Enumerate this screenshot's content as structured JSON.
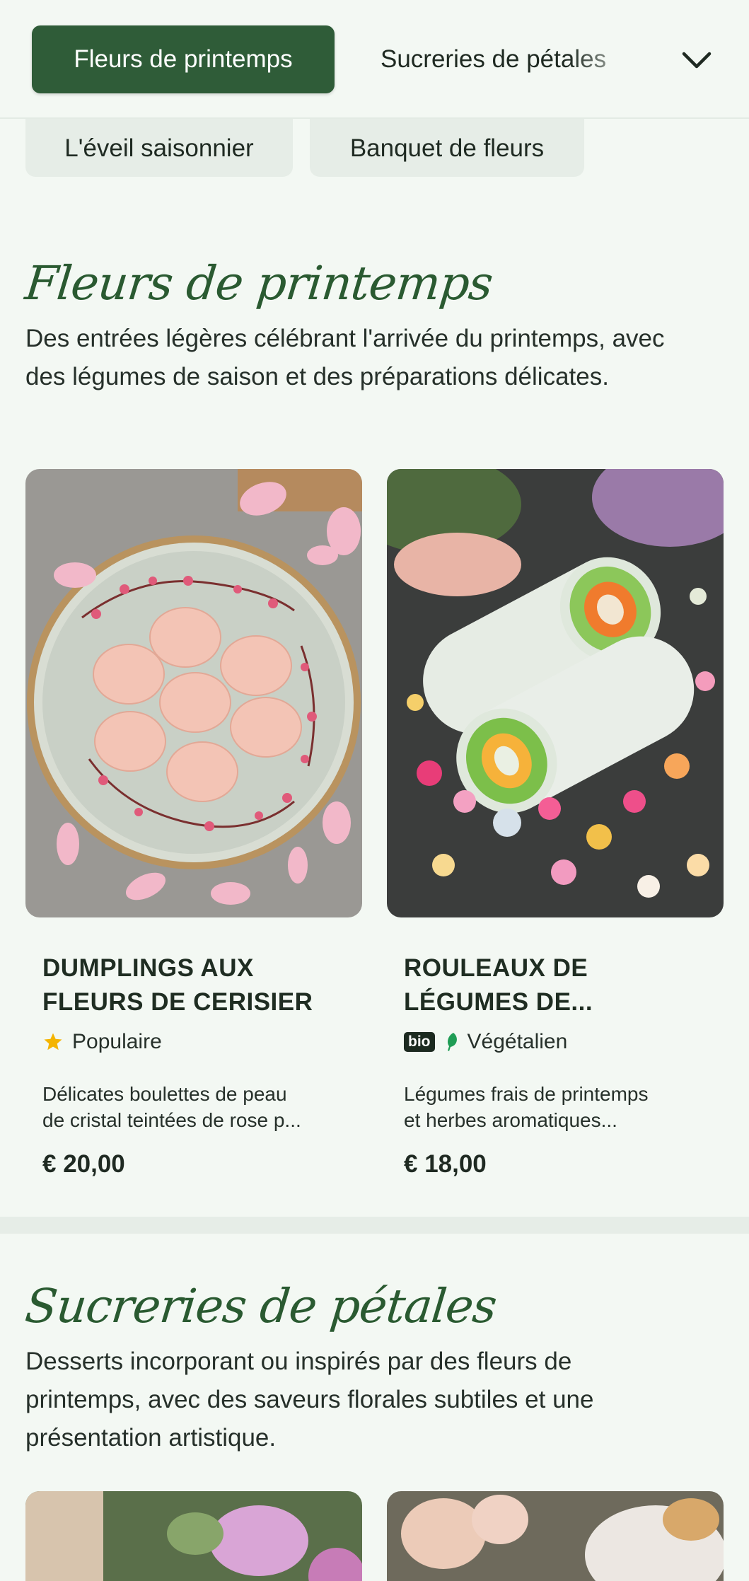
{
  "nav": {
    "active_category": "Fleurs de printemps",
    "next_category": "Sucreries de pétales",
    "chips": [
      "L'éveil saisonnier",
      "Banquet de fleurs"
    ]
  },
  "sections": [
    {
      "title": "Fleurs de printemps",
      "description": "Des entrées légères célébrant l'arrivée du printemps, avec des légumes de saison et des préparations délicates.",
      "items": [
        {
          "name": "DUMPLINGS AUX FLEURS DE CERISIER",
          "tag": "Populaire",
          "tag_icon": "star-icon",
          "description_line1": "Délicates boulettes de peau",
          "description_line2": "de cristal teintées de rose p...",
          "price": "€ 20,00"
        },
        {
          "name": "ROULEAUX DE LÉGUMES DE...",
          "badge": "bio",
          "tag": "Végétalien",
          "tag_icon": "leaf-icon",
          "description_line1": "Légumes frais de printemps",
          "description_line2": "et herbes aromatiques...",
          "price": "€ 18,00"
        }
      ]
    },
    {
      "title": "Sucreries de pétales",
      "description": "Desserts incorporant ou inspirés par des fleurs de printemps, avec des saveurs florales subtiles et une présentation artistique."
    }
  ],
  "colors": {
    "brand_green": "#2f5c38",
    "background": "#f3f8f3",
    "script_green": "#2a5a31",
    "star": "#f4b400",
    "leaf": "#1f9d55"
  }
}
